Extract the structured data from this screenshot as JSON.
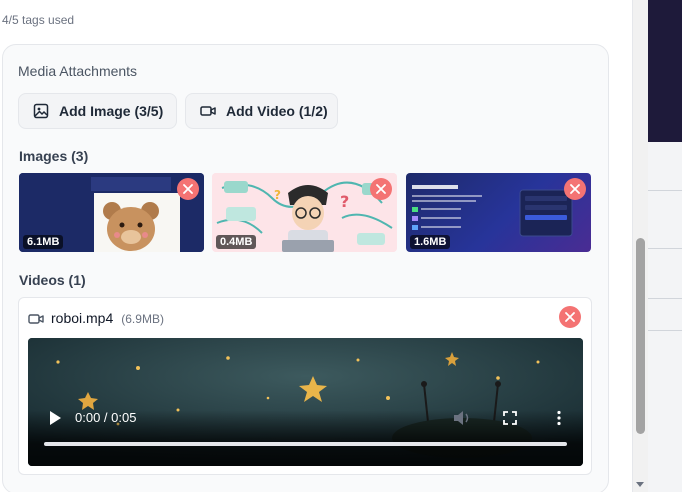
{
  "tags": {
    "usage": "4/5 tags used"
  },
  "media": {
    "title": "Media Attachments",
    "add_image_label": "Add Image (3/5)",
    "add_video_label": "Add Video (1/2)",
    "images_heading": "Images (3)",
    "images": [
      {
        "size": "6.1MB",
        "icon": "teddy-bear-photo"
      },
      {
        "size": "0.4MB",
        "icon": "cartoon-boy-illustration"
      },
      {
        "size": "1.6MB",
        "icon": "login-page-screenshot"
      }
    ],
    "videos_heading": "Videos (1)",
    "video": {
      "filename": "roboi.mp4",
      "size": "(6.9MB)",
      "time": "0:00 / 0:05",
      "progress": 0
    }
  },
  "colors": {
    "remove_button": "#f47373",
    "card_background": "#f9fafb",
    "border": "#e5e7eb"
  }
}
